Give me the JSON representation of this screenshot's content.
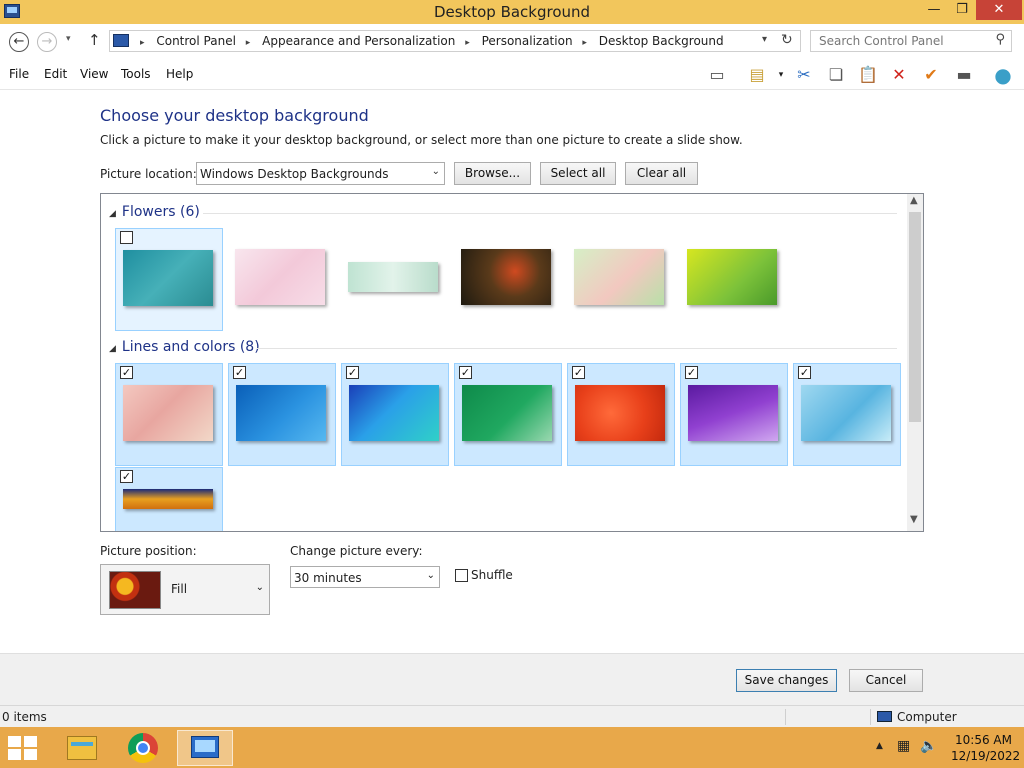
{
  "window": {
    "title": "Desktop Background",
    "min_glyph": "—",
    "max_glyph": "❐",
    "close_glyph": "✕"
  },
  "nav": {
    "back_glyph": "←",
    "fwd_glyph": "→",
    "up_glyph": "↑",
    "drop_glyph": "▾",
    "breadcrumbs": [
      "Control Panel",
      "Appearance and Personalization",
      "Personalization",
      "Desktop Background"
    ],
    "separator_glyph": "▸",
    "refresh_glyph": "↻",
    "search_placeholder": "Search Control Panel",
    "search_glyph": "⚲"
  },
  "menu": [
    "File",
    "Edit",
    "View",
    "Tools",
    "Help"
  ],
  "toolbar": [
    {
      "name": "preview-pane-icon",
      "glyph": "▭",
      "color": "#555555"
    },
    {
      "name": "properties-icon",
      "glyph": "▤",
      "color": "#c9a23a"
    },
    {
      "name": "cut-icon",
      "glyph": "✂",
      "color": "#2a6cc0"
    },
    {
      "name": "copy-icon",
      "glyph": "❏",
      "color": "#555555"
    },
    {
      "name": "paste-icon",
      "glyph": "📋",
      "color": "#8a6a30"
    },
    {
      "name": "delete-icon",
      "glyph": "✕",
      "color": "#d0231c"
    },
    {
      "name": "check-icon",
      "glyph": "✔",
      "color": "#e07a18"
    },
    {
      "name": "details-icon",
      "glyph": "▬",
      "color": "#555555"
    },
    {
      "name": "globe-icon",
      "glyph": "●",
      "color": "#3a9fc8"
    }
  ],
  "main": {
    "heading": "Choose your desktop background",
    "subtext": "Click a picture to make it your desktop background, or select more than one picture to create a slide show.",
    "location_label": "Picture location:",
    "location_value": "Windows Desktop Backgrounds",
    "browse_label": "Browse...",
    "select_all_label": "Select all",
    "clear_all_label": "Clear all",
    "dropdown_glyph": "⌄"
  },
  "gallery": {
    "groups": [
      {
        "title": "Flowers (6)"
      },
      {
        "title": "Lines and colors (8)"
      }
    ],
    "check_glyph": "✓",
    "collapse_glyph": "◢",
    "flowers": [
      {
        "checked": false,
        "gradient": "linear-gradient(135deg, #1f8fa0 0%, #46b0b8 50%, #2b8c92 100%)"
      },
      {
        "checked": false,
        "gradient": "linear-gradient(135deg, #f8e6ee 0%, #f3c9d9 50%, #f7dde8 100%)"
      },
      {
        "checked": false,
        "gradient": "linear-gradient(90deg, #bfe3d2 0%, #e2f3ea 50%, #b9dccb 100%)"
      },
      {
        "checked": false,
        "gradient": "radial-gradient(circle at 60% 40%, #d04a20 0%, #5a3a1a 40%, #1e1a10 100%)"
      },
      {
        "checked": false,
        "gradient": "linear-gradient(135deg, #d6efc6 0%, #f2c8c0 55%, #b8e0a8 100%)"
      },
      {
        "checked": false,
        "gradient": "linear-gradient(135deg, #d6e620 0%, #7cc23a 60%, #4a9a2a 100%)"
      }
    ],
    "lines": [
      {
        "checked": true,
        "gradient": "linear-gradient(135deg, #f3c8c0 0%, #e8a6a0 45%, #f2d8c8 100%)"
      },
      {
        "checked": true,
        "gradient": "linear-gradient(135deg, #0a5fb8 0%, #2a92e0 55%, #56b8f0 100%)"
      },
      {
        "checked": true,
        "gradient": "linear-gradient(135deg, #1a3fb8 0%, #2aa0e8 45%, #30d0c8 100%)"
      },
      {
        "checked": true,
        "gradient": "linear-gradient(135deg, #0e8a4a 0%, #20a860 55%, #9ad8b0 100%)"
      },
      {
        "checked": true,
        "gradient": "radial-gradient(circle at 40% 50%, #ff6a3a 0%, #e8401a 55%, #c42a0e 100%)"
      },
      {
        "checked": true,
        "gradient": "linear-gradient(160deg, #5a1aa0 0%, #9040d0 50%, #d0a8f0 100%)"
      },
      {
        "checked": true,
        "gradient": "linear-gradient(135deg, #9fd8f0 0%, #58b4e0 55%, #c8ecf8 100%)"
      },
      {
        "checked": true,
        "gradient": "linear-gradient(180deg, #1a2a7a 0%, #e8a020 50%, #d07010 100%)"
      }
    ],
    "scroll_up_glyph": "▲",
    "scroll_down_glyph": "▼"
  },
  "options": {
    "position_label": "Picture position:",
    "position_value": "Fill",
    "change_label": "Change picture every:",
    "change_value": "30 minutes",
    "shuffle_label": "Shuffle"
  },
  "footer": {
    "save_label": "Save changes",
    "cancel_label": "Cancel"
  },
  "status": {
    "items": "0 items",
    "computer": "Computer"
  },
  "tray": {
    "up_glyph": "▲",
    "net_glyph": "▦",
    "vol_glyph": "🔈",
    "time": "10:56 AM",
    "date": "12/19/2022"
  }
}
